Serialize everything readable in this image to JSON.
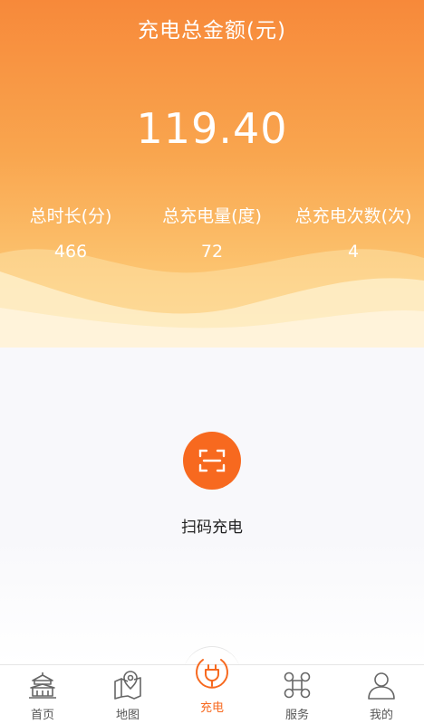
{
  "header": {
    "title": "充电总金额(元)",
    "total_amount": "119.40"
  },
  "stats": [
    {
      "label": "总时长(分)",
      "value": "466"
    },
    {
      "label": "总充电量(度)",
      "value": "72"
    },
    {
      "label": "总充电次数(次)",
      "value": "4"
    }
  ],
  "action": {
    "icon": "scan-icon",
    "label": "扫码充电"
  },
  "nav": {
    "items": [
      {
        "label": "首页",
        "icon": "temple-icon"
      },
      {
        "label": "地图",
        "icon": "map-pin-icon"
      },
      {
        "label": "充电",
        "icon": "plug-icon",
        "active": true
      },
      {
        "label": "服务",
        "icon": "service-icon"
      },
      {
        "label": "我的",
        "icon": "user-icon"
      }
    ]
  },
  "colors": {
    "accent": "#f7691f",
    "header_top": "#f7893a",
    "header_bottom": "#fdd58a"
  }
}
